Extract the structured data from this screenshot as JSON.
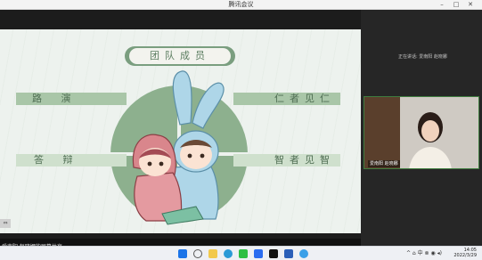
{
  "window": {
    "title": "腾讯会议",
    "controls": [
      "–",
      "□",
      "✕"
    ]
  },
  "slide": {
    "title": "团队成员",
    "left_bars": [
      "路  演",
      "答  辩"
    ],
    "right_bars": [
      "仁者见仁",
      "智者见智"
    ],
    "side_button": "⇔"
  },
  "share": {
    "label": "爱南阳 赵晓娜的屏幕共享"
  },
  "right_panel": {
    "speaking": "正在讲话: 爱南阳 赵晓娜",
    "tile_name": "爱南阳 赵晓娜"
  },
  "taskbar": {
    "time": "14:05",
    "date": "2022/3/29",
    "tray": "^ ⌂ 中 ⊗ ◉ ◂)",
    "icons": [
      "windows",
      "search",
      "explorer",
      "edge",
      "wechat",
      "tencent-meeting",
      "tiktok",
      "word",
      "qq"
    ],
    "colors": {
      "windows": "#1b74e8",
      "edge": "#2b9ad6",
      "wechat": "#2dbf44",
      "word": "#2b5fb8"
    }
  }
}
